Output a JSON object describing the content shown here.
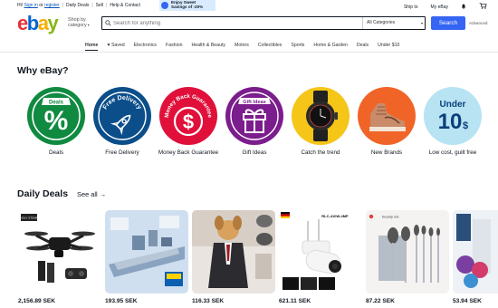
{
  "topbar": {
    "greeting": "Hi!",
    "sign_in": "Sign in",
    "or": "or",
    "register": "register",
    "daily_deals": "Daily Deals",
    "sell": "Sell",
    "help": "Help & Contact",
    "promo_line1": "Enjoy Sweet",
    "promo_line2": "Savings of -20%",
    "ship_to": "Ship to",
    "my_ebay": "My eBay"
  },
  "header": {
    "logo": [
      "e",
      "b",
      "a",
      "y"
    ],
    "shop_by_line1": "Shop by",
    "shop_by_line2": "category",
    "search_placeholder": "Search for anything",
    "category_select": "All Categories",
    "search_button": "Search",
    "advanced": "Advanced"
  },
  "nav": {
    "items": [
      "Home",
      "♥ Saved",
      "Electronics",
      "Fashion",
      "Health & Beauty",
      "Motors",
      "Collectibles",
      "Sports",
      "Home & Garden",
      "Deals",
      "Under $10"
    ]
  },
  "why": {
    "title": "Why eBay?",
    "items": [
      {
        "label": "Deals",
        "badge": "Deals",
        "glyph": "%"
      },
      {
        "label": "Free Delivery",
        "badge": "Free Delivery"
      },
      {
        "label": "Money Back Guarantee",
        "badge": "Money Back Guarantee",
        "glyph": "$"
      },
      {
        "label": "Gift Ideas",
        "badge": "Gift Ideas"
      },
      {
        "label": "Catch the trend"
      },
      {
        "label": "New Brands"
      },
      {
        "label": "Low cost, guilt free",
        "badge_line1": "Under",
        "badge_line2": "10",
        "badge_currency": "$"
      }
    ],
    "colors": [
      "#0f8a40",
      "#0b4e8a",
      "#e0103a",
      "#7b1d8c",
      "#f5c518",
      "#f06427",
      "#b7e3f3"
    ]
  },
  "deals": {
    "title": "Daily Deals",
    "see_all": "See all →",
    "items": [
      {
        "price": "2,156.89 SEK",
        "brand": "HOLY STONE"
      },
      {
        "price": "193.95 SEK"
      },
      {
        "price": "116.33 SEK"
      },
      {
        "price": "621.11 SEK",
        "model": "RLC-410W-4MP"
      },
      {
        "price": "87.22 SEK",
        "brand": "beauty est"
      },
      {
        "price": "53.94 SEK"
      }
    ]
  }
}
